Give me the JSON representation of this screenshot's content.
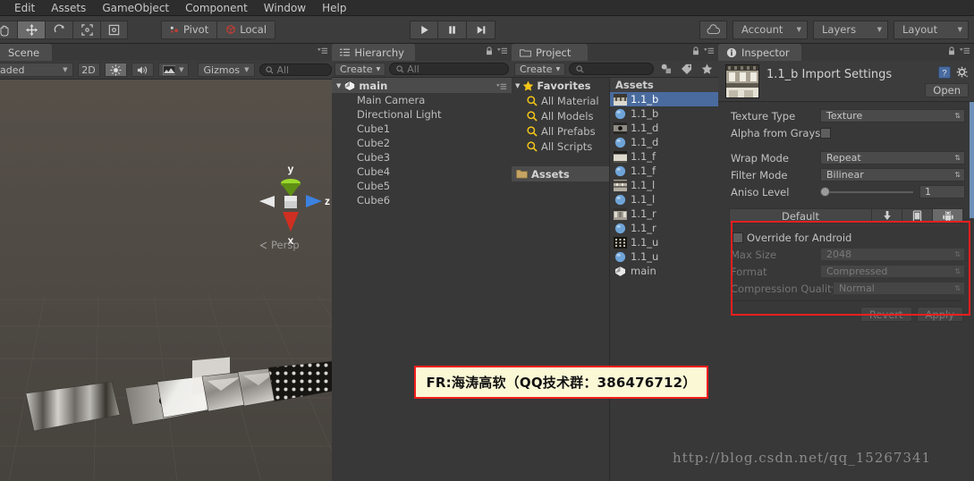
{
  "menubar": {
    "items": [
      {
        "label": "Edit"
      },
      {
        "label": "Assets"
      },
      {
        "label": "GameObject"
      },
      {
        "label": "Component"
      },
      {
        "label": "Window"
      },
      {
        "label": "Help"
      }
    ]
  },
  "toolbar": {
    "tools": [
      {
        "name": "hand-tool",
        "active": false
      },
      {
        "name": "move-tool",
        "active": true
      },
      {
        "name": "rotate-tool",
        "active": false
      },
      {
        "name": "scale-tool",
        "active": false
      },
      {
        "name": "rect-tool",
        "active": false
      }
    ],
    "pivot_label": "Pivot",
    "local_label": "Local",
    "play_label": "play-icon",
    "pause_label": "pause-icon",
    "step_label": "step-icon",
    "cloud_label": "cloud-icon",
    "account_label": "Account",
    "layers_label": "Layers",
    "layout_label": "Layout"
  },
  "scene": {
    "tab_label": "Scene",
    "draw_mode": "aded",
    "mode_2d": "2D",
    "gizmos_label": "Gizmos",
    "search_placeholder": "All",
    "axis_labels": {
      "y": "y",
      "z": "z",
      "x": "x"
    },
    "persp_label": "Persp",
    "object_count": 6
  },
  "hierarchy": {
    "tab_label": "Hierarchy",
    "create_label": "Create",
    "search_placeholder": "All",
    "scene_name": "main",
    "items": [
      {
        "label": "Main Camera"
      },
      {
        "label": "Directional Light"
      },
      {
        "label": "Cube1"
      },
      {
        "label": "Cube2"
      },
      {
        "label": "Cube3"
      },
      {
        "label": "Cube4"
      },
      {
        "label": "Cube5"
      },
      {
        "label": "Cube6"
      }
    ]
  },
  "project": {
    "tab_label": "Project",
    "create_label": "Create",
    "search_placeholder": "",
    "favorites_label": "Favorites",
    "favorites": [
      {
        "label": "All Material"
      },
      {
        "label": "All Models"
      },
      {
        "label": "All Prefabs"
      },
      {
        "label": "All Scripts"
      }
    ],
    "assets_label": "Assets",
    "assets_column_header": "Assets",
    "assets": [
      {
        "label": "1.1_b",
        "icon": "texture-icon",
        "selected": true
      },
      {
        "label": "1.1_b",
        "icon": "material-icon",
        "selected": false
      },
      {
        "label": "1.1_d",
        "icon": "texture-icon",
        "selected": false
      },
      {
        "label": "1.1_d",
        "icon": "material-icon",
        "selected": false
      },
      {
        "label": "1.1_f",
        "icon": "texture-icon",
        "selected": false
      },
      {
        "label": "1.1_f",
        "icon": "material-icon",
        "selected": false
      },
      {
        "label": "1.1_l",
        "icon": "texture-icon",
        "selected": false
      },
      {
        "label": "1.1_l",
        "icon": "material-icon",
        "selected": false
      },
      {
        "label": "1.1_r",
        "icon": "texture-icon",
        "selected": false
      },
      {
        "label": "1.1_r",
        "icon": "material-icon",
        "selected": false
      },
      {
        "label": "1.1_u",
        "icon": "texture-icon",
        "selected": false
      },
      {
        "label": "1.1_u",
        "icon": "material-icon",
        "selected": false
      },
      {
        "label": "main",
        "icon": "scene-icon",
        "selected": false
      }
    ]
  },
  "inspector": {
    "tab_label": "Inspector",
    "title": "1.1_b Import Settings",
    "open_label": "Open",
    "fields": [
      {
        "label": "Texture Type",
        "value": "Texture",
        "control": "dropdown"
      },
      {
        "label": "Alpha from Grayscal",
        "value": "",
        "control": "checkbox"
      },
      {
        "label": "Wrap Mode",
        "value": "Repeat",
        "control": "dropdown"
      },
      {
        "label": "Filter Mode",
        "value": "Bilinear",
        "control": "dropdown"
      },
      {
        "label": "Aniso Level",
        "value": "1",
        "control": "slider"
      }
    ],
    "platform_bar": {
      "default_label": "Default",
      "tabs": [
        {
          "name": "standalone-icon",
          "active": false
        },
        {
          "name": "ios-icon",
          "active": false
        },
        {
          "name": "android-icon",
          "active": true
        }
      ]
    },
    "override": {
      "title": "Override for Android",
      "checked": false,
      "fields": [
        {
          "label": "Max Size",
          "value": "2048"
        },
        {
          "label": "Format",
          "value": "Compressed"
        },
        {
          "label": "Compression Quality",
          "value": "Normal"
        }
      ],
      "revert_label": "Revert",
      "apply_label": "Apply"
    }
  },
  "annotation": {
    "text": "FR:海涛高软（QQ技术群：386476712）",
    "border_color": "#f01d1d",
    "bg_color": "#fbf8d6"
  },
  "watermark": {
    "text": "http://blog.csdn.net/qq_15267341"
  }
}
